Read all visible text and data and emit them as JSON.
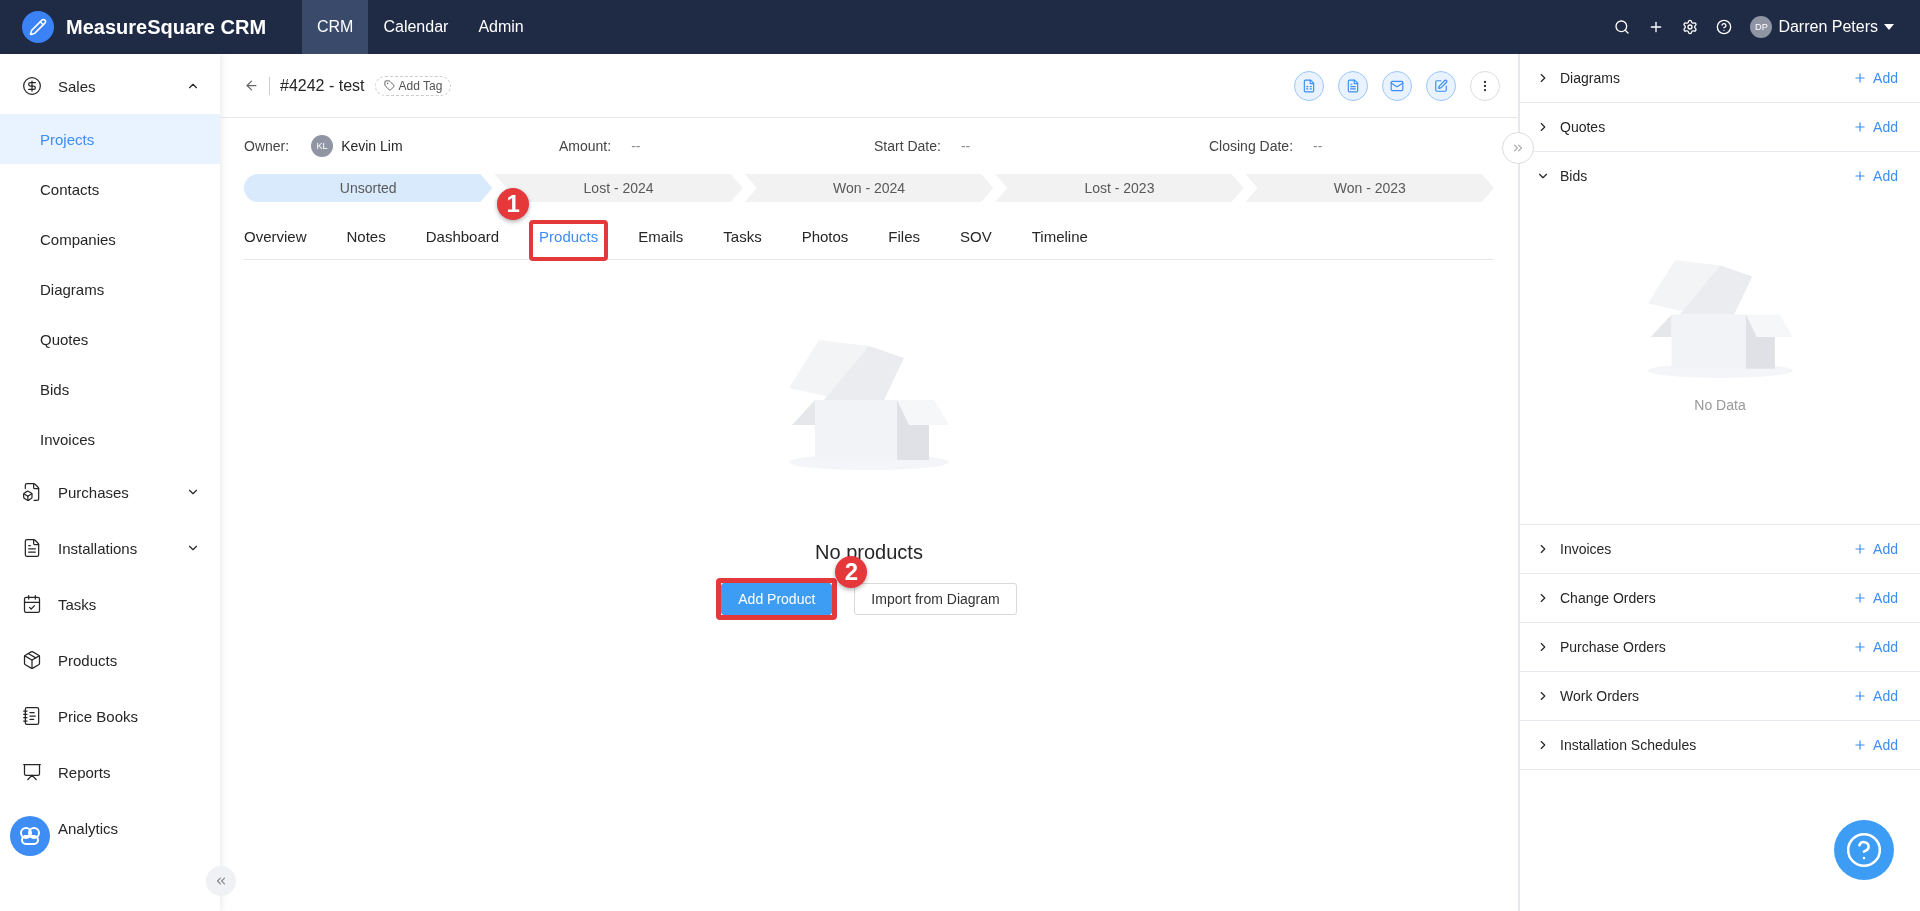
{
  "app": {
    "name": "MeasureSquare CRM"
  },
  "top_nav": [
    {
      "label": "CRM",
      "selected": true
    },
    {
      "label": "Calendar",
      "selected": false
    },
    {
      "label": "Admin",
      "selected": false
    }
  ],
  "user": {
    "initials": "DP",
    "name": "Darren Peters"
  },
  "sidebar": {
    "items": [
      {
        "label": "Sales",
        "selected": false,
        "expanded": true,
        "children": [
          {
            "label": "Projects",
            "selected": true
          },
          {
            "label": "Contacts",
            "selected": false
          },
          {
            "label": "Companies",
            "selected": false
          },
          {
            "label": "Diagrams",
            "selected": false
          },
          {
            "label": "Quotes",
            "selected": false
          },
          {
            "label": "Bids",
            "selected": false
          },
          {
            "label": "Invoices",
            "selected": false
          }
        ]
      },
      {
        "label": "Purchases",
        "selected": false,
        "expanded": false
      },
      {
        "label": "Installations",
        "selected": false,
        "expanded": false
      },
      {
        "label": "Tasks",
        "selected": false
      },
      {
        "label": "Products",
        "selected": false
      },
      {
        "label": "Price Books",
        "selected": false
      },
      {
        "label": "Reports",
        "selected": false
      },
      {
        "label": "Analytics",
        "selected": false
      }
    ]
  },
  "record": {
    "title": "#4242 - test",
    "add_tag": "Add Tag",
    "fields": [
      {
        "label": "Owner:",
        "value": "Kevin Lim",
        "initials": "KL"
      },
      {
        "label": "Amount:",
        "value": "--"
      },
      {
        "label": "Start Date:",
        "value": "--"
      },
      {
        "label": "Closing Date:",
        "value": "--"
      }
    ],
    "stages": [
      {
        "label": "Unsorted",
        "selected": true
      },
      {
        "label": "Lost - 2024",
        "selected": false
      },
      {
        "label": "Won - 2024",
        "selected": false
      },
      {
        "label": "Lost - 2023",
        "selected": false
      },
      {
        "label": "Won - 2023",
        "selected": false
      }
    ],
    "tabs": [
      {
        "label": "Overview",
        "selected": false
      },
      {
        "label": "Notes",
        "selected": false
      },
      {
        "label": "Dashboard",
        "selected": false
      },
      {
        "label": "Products",
        "selected": true,
        "annotation": "1"
      },
      {
        "label": "Emails",
        "selected": false
      },
      {
        "label": "Tasks",
        "selected": false
      },
      {
        "label": "Photos",
        "selected": false
      },
      {
        "label": "Files",
        "selected": false
      },
      {
        "label": "SOV",
        "selected": false
      },
      {
        "label": "Timeline",
        "selected": false
      }
    ],
    "empty": {
      "message": "No products",
      "buttons": [
        {
          "label": "Add Product",
          "kind": "primary",
          "annotation": "2"
        },
        {
          "label": "Import from Diagram",
          "kind": "default"
        }
      ]
    }
  },
  "right_panel": {
    "sections": [
      {
        "label": "Diagrams",
        "expanded": false,
        "add": "Add"
      },
      {
        "label": "Quotes",
        "expanded": false,
        "add": "Add"
      },
      {
        "label": "Bids",
        "expanded": true,
        "add": "Add",
        "empty": "No Data"
      },
      {
        "label": "Invoices",
        "expanded": false,
        "add": "Add"
      },
      {
        "label": "Change Orders",
        "expanded": false,
        "add": "Add"
      },
      {
        "label": "Purchase Orders",
        "expanded": false,
        "add": "Add"
      },
      {
        "label": "Work Orders",
        "expanded": false,
        "add": "Add"
      },
      {
        "label": "Installation Schedules",
        "expanded": false,
        "add": "Add"
      }
    ]
  }
}
